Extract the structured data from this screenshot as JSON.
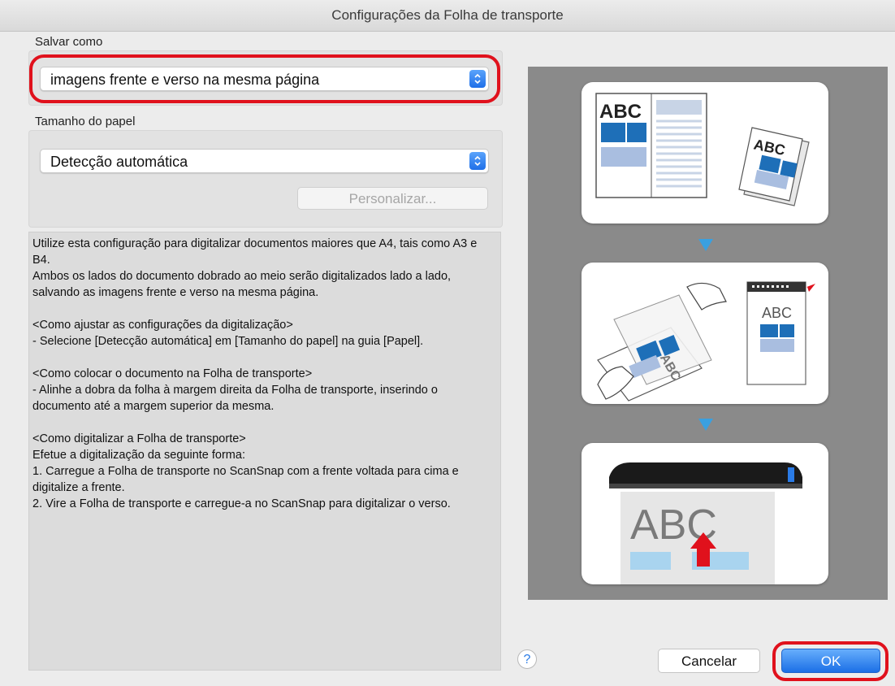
{
  "window": {
    "title": "Configurações da Folha de transporte"
  },
  "save_as": {
    "label": "Salvar como",
    "selected": "imagens frente e verso na mesma página"
  },
  "paper_size": {
    "label": "Tamanho do papel",
    "selected": "Detecção automática",
    "customize_label": "Personalizar..."
  },
  "description": {
    "lines": [
      "Utilize esta configuração para digitalizar documentos maiores que A4, tais como A3 e B4.",
      "Ambos os lados do documento dobrado ao meio serão digitalizados lado a lado, salvando as imagens frente e verso na mesma página.",
      "",
      "<Como ajustar as configurações da digitalização>",
      "- Selecione [Detecção automática] em [Tamanho do papel] na guia [Papel].",
      "",
      "<Como colocar o documento na Folha de transporte>",
      "- Alinhe a dobra da folha à margem direita da Folha de transporte, inserindo o documento até a margem superior da mesma.",
      "",
      "<Como digitalizar a Folha de transporte>",
      "Efetue a digitalização da seguinte forma:",
      "1. Carregue a Folha de transporte no ScanSnap com a frente voltada para cima e digitalize a frente.",
      "2. Vire a Folha de transporte e carregue-a no ScanSnap para digitalizar o verso."
    ]
  },
  "illustration": {
    "abc_text": "ABC"
  },
  "footer": {
    "help_label": "?",
    "cancel_label": "Cancelar",
    "ok_label": "OK"
  },
  "colors": {
    "accent_blue": "#1f6fe8",
    "highlight_red": "#e0111c",
    "illustration_bg": "#8a8a8a"
  }
}
